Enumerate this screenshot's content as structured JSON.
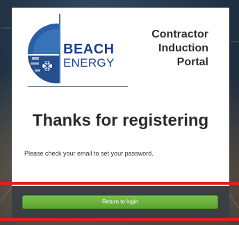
{
  "brand": {
    "name_line1": "BEACH",
    "name_line2": "ENERGY",
    "color_primary": "#1d3f86"
  },
  "portal": {
    "title_line1": "Contractor",
    "title_line2": "Induction",
    "title_line3": "Portal"
  },
  "main": {
    "heading": "Thanks for registering",
    "message": "Please check your email to set your password."
  },
  "actions": {
    "return_label": "Return to login",
    "button_color": "#5aa32f"
  },
  "highlight": {
    "color": "#e02020"
  }
}
